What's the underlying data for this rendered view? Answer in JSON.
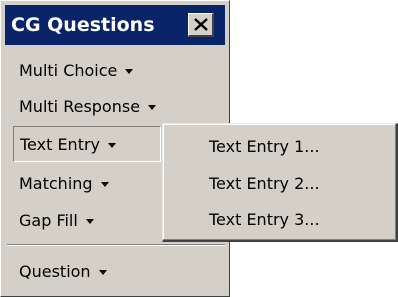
{
  "window": {
    "title": "CG Questions",
    "close_icon": "close-icon"
  },
  "menu": {
    "items": [
      {
        "label": "Multi Choice",
        "has_dropdown": true
      },
      {
        "label": "Multi Response",
        "has_dropdown": true
      },
      {
        "label": "Text Entry",
        "has_dropdown": true,
        "pressed": true
      },
      {
        "label": "Matching",
        "has_dropdown": true
      },
      {
        "label": "Gap Fill",
        "has_dropdown": true
      },
      {
        "label": "Question",
        "has_dropdown": true
      }
    ]
  },
  "submenu": {
    "items": [
      {
        "label": "Text Entry 1..."
      },
      {
        "label": "Text Entry 2..."
      },
      {
        "label": "Text Entry 3..."
      }
    ]
  },
  "colors": {
    "titlebar": "#0a246a",
    "face": "#d4d0c8"
  }
}
